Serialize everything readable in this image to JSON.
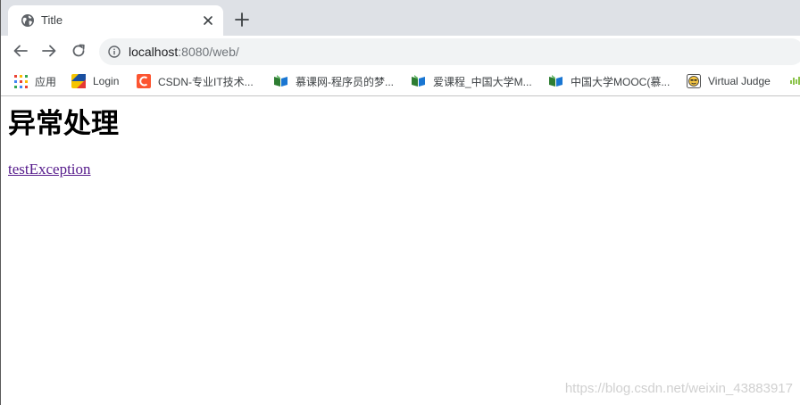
{
  "tab": {
    "title": "Title",
    "favicon": "globe-icon"
  },
  "toolbar": {
    "url_host": "localhost",
    "url_rest": ":8080/web/"
  },
  "bookmarks": [
    {
      "label": "应用",
      "icon": "apps-grid-icon"
    },
    {
      "label": "Login",
      "icon": "login-favicon"
    },
    {
      "label": "CSDN-专业IT技术...",
      "icon": "csdn-favicon"
    },
    {
      "label": "慕课网-程序员的梦...",
      "icon": "book-favicon"
    },
    {
      "label": "爱课程_中国大学M...",
      "icon": "book-favicon"
    },
    {
      "label": "中国大学MOOC(慕...",
      "icon": "book-favicon"
    },
    {
      "label": "Virtual Judge",
      "icon": "vjudge-favicon"
    }
  ],
  "page": {
    "heading": "异常处理",
    "link_text": "testException"
  },
  "watermark": "https://blog.csdn.net/weixin_43883917",
  "colors": {
    "tabstrip": "#dee1e6",
    "omnibox": "#f1f3f4",
    "visited_link": "#551a8b",
    "csdn": "#fc5531"
  }
}
